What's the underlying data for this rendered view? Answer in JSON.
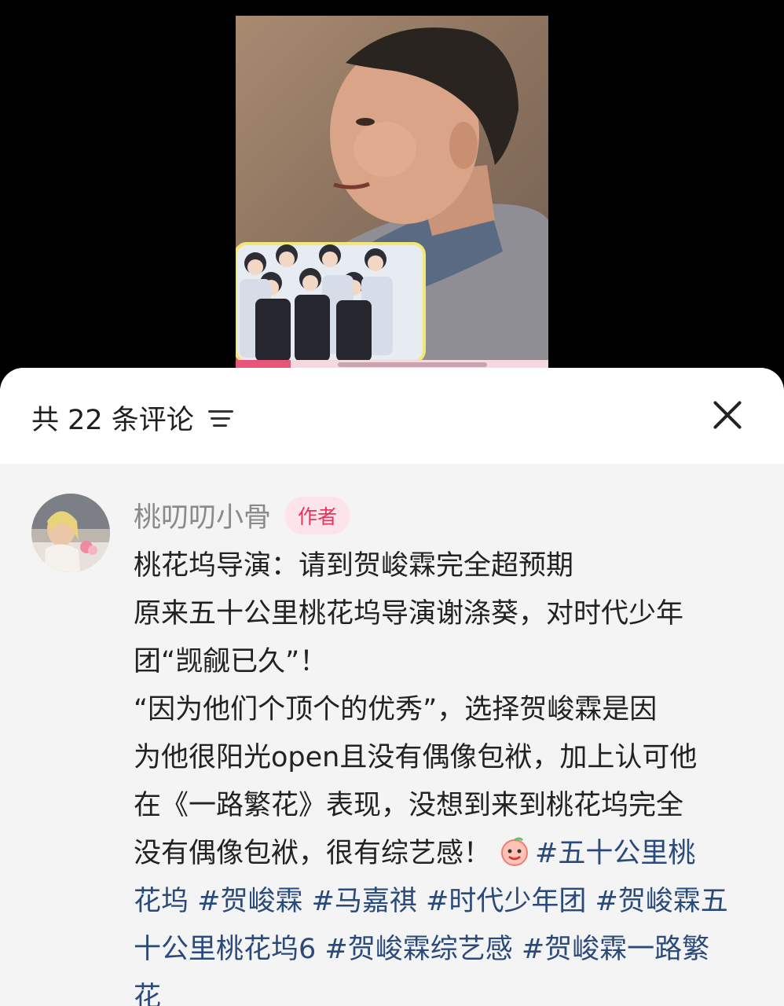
{
  "sheet": {
    "comment_count": "共 22 条评论"
  },
  "comment": {
    "author": "桃叨叨小骨",
    "badge": "作者",
    "lines": [
      "桃花坞导演：请到贺峻霖完全超预期",
      "原来五十公里桃花坞导演谢涤葵，对时代少年",
      "团“觊觎已久”！",
      "“因为他们个顶个的优秀”，选择贺峻霖是因",
      "为他很阳光open且没有偶像包袱，加上认可他",
      "在《一路繁花》表现，没想到来到桃花坞完全",
      "没有偶像包袱，很有综艺感！"
    ],
    "hashtags_line1_tail": "#五十公里桃",
    "hashtags_line2": "花坞 #贺峻霖 #马嘉祺 #时代少年团 #贺峻霖五",
    "hashtags_line3": "十公里桃花坞6 #贺峻霖综艺感 #贺峻霖一路繁",
    "hashtags_line4": "花"
  },
  "colors": {
    "hashtag": "#2a4a7b",
    "badge_text": "#e8335a",
    "badge_bg": "#fde4ea"
  }
}
